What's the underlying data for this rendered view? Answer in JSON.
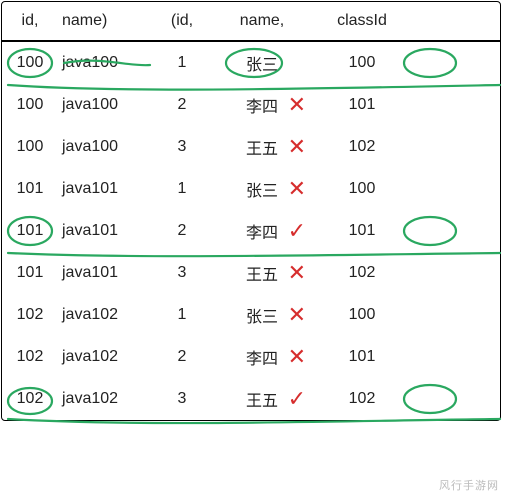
{
  "header": {
    "col1": "id,",
    "col2": "name)",
    "col3": "(id,",
    "col4": "name,",
    "col5": "classId"
  },
  "rows": [
    {
      "c1": "100",
      "c2": "java100",
      "c3": "1",
      "c4": "张三",
      "c5": "100",
      "mark": ""
    },
    {
      "c1": "100",
      "c2": "java100",
      "c3": "2",
      "c4": "李四",
      "c5": "101",
      "mark": "cross"
    },
    {
      "c1": "100",
      "c2": "java100",
      "c3": "3",
      "c4": "王五",
      "c5": "102",
      "mark": "cross"
    },
    {
      "c1": "101",
      "c2": "java101",
      "c3": "1",
      "c4": "张三",
      "c5": "100",
      "mark": "cross"
    },
    {
      "c1": "101",
      "c2": "java101",
      "c3": "2",
      "c4": "李四",
      "c5": "101",
      "mark": "check"
    },
    {
      "c1": "101",
      "c2": "java101",
      "c3": "3",
      "c4": "王五",
      "c5": "102",
      "mark": "cross"
    },
    {
      "c1": "102",
      "c2": "java102",
      "c3": "1",
      "c4": "张三",
      "c5": "100",
      "mark": "cross"
    },
    {
      "c1": "102",
      "c2": "java102",
      "c3": "2",
      "c4": "李四",
      "c5": "101",
      "mark": "cross"
    },
    {
      "c1": "102",
      "c2": "java102",
      "c3": "3",
      "c4": "王五",
      "c5": "102",
      "mark": "check"
    }
  ],
  "watermark": "风行手游网",
  "annotations": {
    "circles": [
      "row0-id",
      "row0-name",
      "row0-classId",
      "row4-id",
      "row4-classId",
      "row8-id",
      "row8-classId"
    ],
    "underlines": [
      "row0",
      "row4",
      "row8"
    ]
  }
}
